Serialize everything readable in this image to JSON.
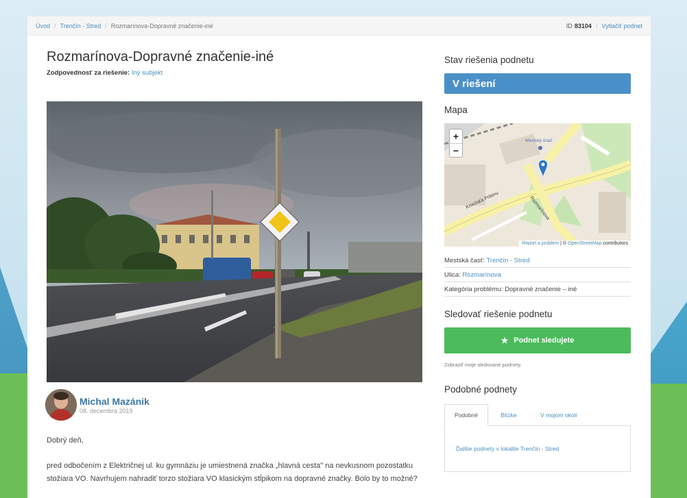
{
  "breadcrumb": {
    "items": [
      "Úvod",
      "Trenčín - Stred",
      "Rozmarínova-Dopravné značenie-iné"
    ],
    "id_label": "ID",
    "id_value": "83104",
    "print_label": "Vytlačiť podnet"
  },
  "issue": {
    "title": "Rozmarínova-Dopravné značenie-iné",
    "responsibility_label": "Zodpovednosť za riešenie:",
    "responsibility_value": "Iný subjekt"
  },
  "author": {
    "name": "Michal Mazánik",
    "date": "08. decembra 2019"
  },
  "body": {
    "greeting": "Dobrý deň,",
    "text": "pred odbočením z Električnej ul. ku gymnáziu je umiestnená značka „hlavná cesta\" na nevkusnom pozostatku stožiara VO. Navrhujem nahradiť torzo stožiara VO klasickým stĺpikom na dopravné značky. Bolo by to možné?"
  },
  "status": {
    "section_title": "Stav riešenia podnetu",
    "value": "V riešení",
    "color": "#4a90c8"
  },
  "map": {
    "section_title": "Mapa",
    "zoom_in": "+",
    "zoom_out": "−",
    "attribution_link1": "Report a problem",
    "attribution_sep": " | © ",
    "attribution_link2": "OpenStreetMap",
    "attribution_tail": " contributors",
    "label_street1": "Kniežaťa Pribinu",
    "label_street2": "Rozmarínova",
    "label_poi": "Mestský úrad"
  },
  "info": {
    "district_label": "Mestská časť:",
    "district_value": "Trenčín - Stred",
    "street_label": "Ulica:",
    "street_value": "Rozmarínova",
    "category_label": "Kategória problému:",
    "category_value": "Dopravné značenie – iné"
  },
  "follow": {
    "section_title": "Sledovať riešenie podnetu",
    "button_label": "Podnet sledujete",
    "button_color": "#4cbb5c",
    "link_label": "Zobraziť moje sledované podnety."
  },
  "similar": {
    "section_title": "Podobné podnety",
    "tabs": [
      "Podobné",
      "Blízke",
      "V mojom okolí"
    ],
    "active_tab": 0,
    "panel_link": "Ďalšie podnety v lokalite Trenčín - Stred"
  }
}
